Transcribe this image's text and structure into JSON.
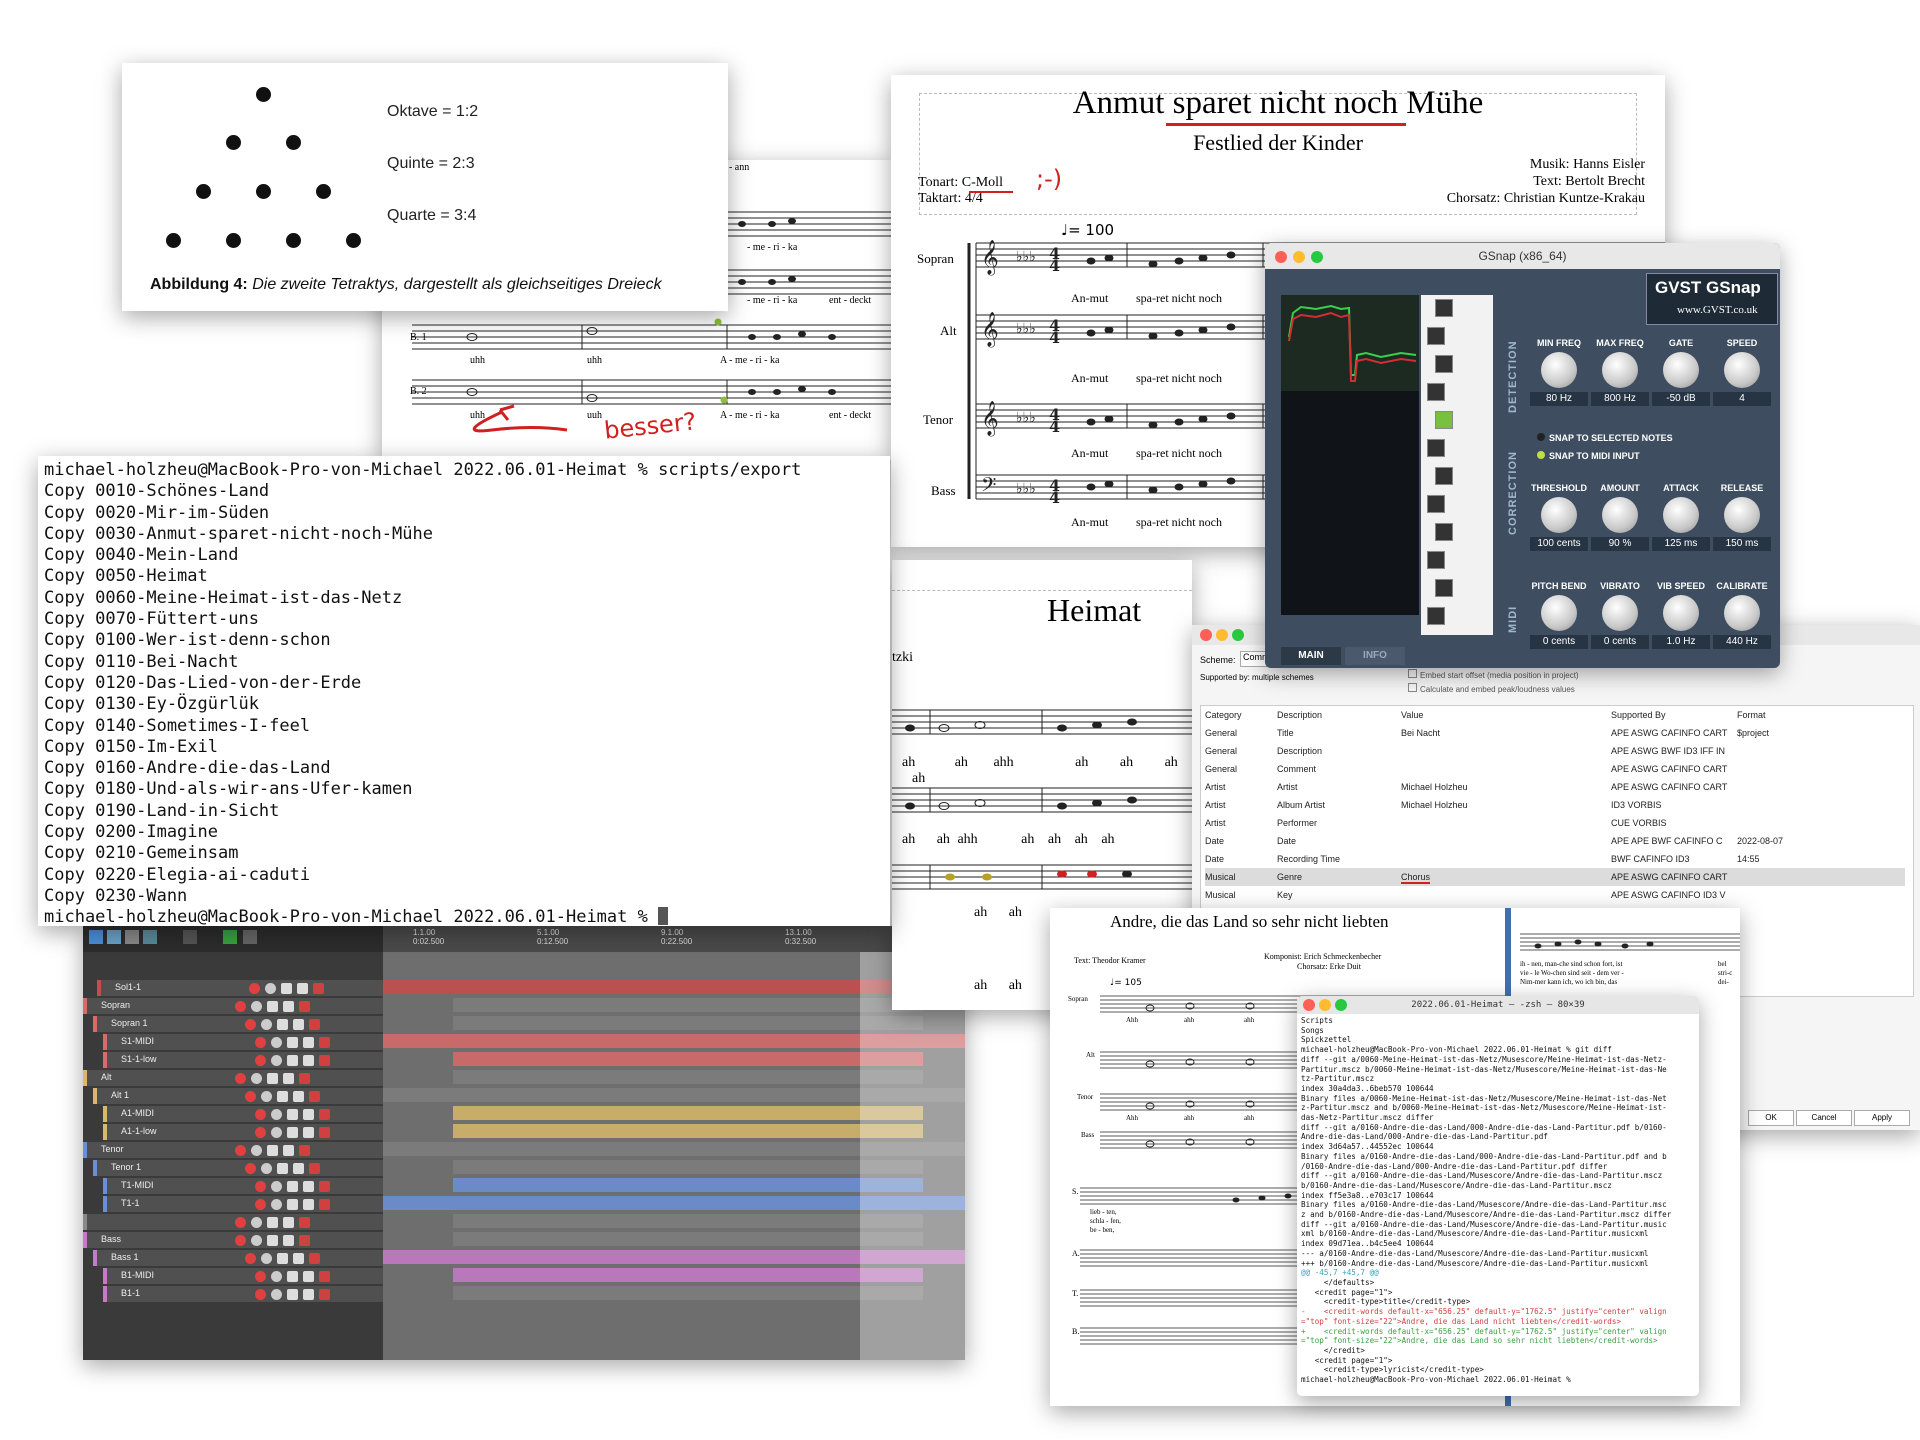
{
  "tetraktys": {
    "ratios": [
      "Oktave = 1:2",
      "Quinte = 2:3",
      "Quarte = 3:4"
    ],
    "caption_label": "Abbildung 4:",
    "caption_text": "Die zweite Tetraktys, dargestellt als gleichseitiges Dreieck"
  },
  "score_bg": {
    "lyrics": [
      "ann - ann",
      "- me - ri - ka",
      "- me - ri - ka",
      "ent - deckt",
      "uhh",
      "uhh",
      "A - me - ri - ka",
      "uhh",
      "uuh",
      "A - me - ri - ka",
      "ent - deckt"
    ],
    "staff_labels": [
      "B. 1",
      "B. 2"
    ],
    "annotation": "besser?"
  },
  "anmut": {
    "title": "Anmut sparet nicht noch Mühe",
    "subtitle": "Festlied der Kinder",
    "tonart": "Tonart: C-Moll",
    "smiley": ";-)",
    "taktart": "Taktart: 4/4",
    "musik": "Musik: Hanns Eisler",
    "text": "Text: Bertolt Brecht",
    "chorsatz": "Chorsatz: Christian Kuntze-Krakau",
    "tempo": "♩= 100",
    "parts": [
      "Sopran",
      "Alt",
      "Tenor",
      "Bass"
    ],
    "lyrics": [
      "An-mut",
      "spa-ret nicht noch"
    ]
  },
  "heimat": {
    "title": "Heimat",
    "partial": "tzki",
    "lyrics_row": [
      "ah",
      "ah",
      "ahh",
      "ah",
      "ah",
      "ah",
      "ah"
    ],
    "lyrics_row2": [
      "ah",
      "ah",
      "ahh",
      "ah",
      "ah",
      "ah",
      "ah"
    ],
    "lyrics_row3": [
      "ah",
      "ah"
    ],
    "lyrics_row4": [
      "ah",
      "ah"
    ]
  },
  "terminal": {
    "prompt": "michael-holzheu@MacBook-Pro-von-Michael 2022.06.01-Heimat % scripts/export",
    "lines": [
      "Copy 0010-Schönes-Land",
      "Copy 0020-Mir-im-Süden",
      "Copy 0030-Anmut-sparet-nicht-noch-Mühe",
      "Copy 0040-Mein-Land",
      "Copy 0050-Heimat",
      "Copy 0060-Meine-Heimat-ist-das-Netz",
      "Copy 0070-Füttert-uns",
      "Copy 0100-Wer-ist-denn-schon",
      "Copy 0110-Bei-Nacht",
      "Copy 0120-Das-Lied-von-der-Erde",
      "Copy 0130-Ey-Özgürlük",
      "Copy 0140-Sometimes-I-feel",
      "Copy 0150-Im-Exil",
      "Copy 0160-Andre-die-das-Land",
      "Copy 0180-Und-als-wir-ans-Ufer-kamen",
      "Copy 0190-Land-in-Sicht",
      "Copy 0200-Imagine",
      "Copy 0210-Gemeinsam",
      "Copy 0220-Elegia-ai-caduti",
      "Copy 0230-Wann"
    ],
    "end_prompt": "michael-holzheu@MacBook-Pro-von-Michael 2022.06.01-Heimat % "
  },
  "daw": {
    "ruler": [
      "1.1.00\n0:02.500",
      "5.1.00\n0:12.500",
      "9.1.00\n0:22.500",
      "13.1.00\n0:32.500",
      "17.1.00\n0:42.500"
    ],
    "tracks": [
      {
        "name": "Sol1-1",
        "color": "#c94b4b"
      },
      {
        "name": "Sopran",
        "color": "#d96a6a"
      },
      {
        "name": "Sopran 1",
        "color": "#d96a6a"
      },
      {
        "name": "S1-MIDI",
        "color": "#d96a6a"
      },
      {
        "name": "S1-1-low",
        "color": "#d96a6a"
      },
      {
        "name": "Alt",
        "color": "#d8b86a"
      },
      {
        "name": "Alt 1",
        "color": "#d8b86a"
      },
      {
        "name": "A1-MIDI",
        "color": "#d8b86a"
      },
      {
        "name": "A1-1-low",
        "color": "#d8b86a"
      },
      {
        "name": "Tenor",
        "color": "#6a8fd8"
      },
      {
        "name": "Tenor 1",
        "color": "#6a8fd8"
      },
      {
        "name": "T1-MIDI",
        "color": "#6a8fd8"
      },
      {
        "name": "T1-1",
        "color": "#6a8fd8"
      },
      {
        "name": "",
        "color": "#888888"
      },
      {
        "name": "Bass",
        "color": "#c77ac7"
      },
      {
        "name": "Bass 1",
        "color": "#c77ac7"
      },
      {
        "name": "B1-MIDI",
        "color": "#c77ac7"
      },
      {
        "name": "B1-1",
        "color": "#c77ac7"
      }
    ]
  },
  "gsnap": {
    "window_title": "GSnap (x86_64)",
    "logo": "GVST GSnap",
    "url": "www.GVST.co.uk",
    "sections": [
      "DETECTION",
      "CORRECTION",
      "MIDI"
    ],
    "detection": [
      {
        "label": "MIN FREQ",
        "value": "80 Hz"
      },
      {
        "label": "MAX FREQ",
        "value": "800 Hz"
      },
      {
        "label": "GATE",
        "value": "-50 dB"
      },
      {
        "label": "SPEED",
        "value": "4"
      }
    ],
    "options": [
      "SNAP TO SELECTED NOTES",
      "SNAP TO MIDI INPUT"
    ],
    "correction": [
      {
        "label": "THRESHOLD",
        "value": "100 cents"
      },
      {
        "label": "AMOUNT",
        "value": "90 %"
      },
      {
        "label": "ATTACK",
        "value": "125 ms"
      },
      {
        "label": "RELEASE",
        "value": "150 ms"
      }
    ],
    "midi": [
      {
        "label": "PITCH BEND",
        "value": "0 cents"
      },
      {
        "label": "VIBRATO",
        "value": "0 cents"
      },
      {
        "label": "VIB SPEED",
        "value": "1.0 Hz"
      },
      {
        "label": "CALIBRATE",
        "value": "440 Hz"
      }
    ],
    "tabs": [
      "MAIN",
      "INFO"
    ]
  },
  "metadata": {
    "scheme_label": "Scheme:",
    "scheme_value": "Comm",
    "supported_label": "Supported by:",
    "supported_value": "multiple schemes",
    "checkbox1": "Embed start offset (media position in project)",
    "checkbox2": "Calculate and embed peak/loudness values",
    "columns": [
      "Category",
      "Description",
      "Value",
      "Supported By",
      "Format"
    ],
    "rows": [
      [
        "General",
        "Title",
        "Bei Nacht",
        "APE ASWG CAFINFO CART",
        "$project"
      ],
      [
        "General",
        "Description",
        "",
        "APE ASWG BWF ID3 IFF IN",
        ""
      ],
      [
        "General",
        "Comment",
        "",
        "APE ASWG CAFINFO CART",
        ""
      ],
      [
        "Artist",
        "Artist",
        "Michael Holzheu",
        "APE ASWG CAFINFO CART",
        ""
      ],
      [
        "Artist",
        "Album Artist",
        "Michael Holzheu",
        "ID3 VORBIS",
        ""
      ],
      [
        "Artist",
        "Performer",
        "",
        "CUE VORBIS",
        ""
      ],
      [
        "Date",
        "Date",
        "",
        "APE APE BWF CAFINFO C",
        "2022-08-07"
      ],
      [
        "Date",
        "Recording Time",
        "",
        "BWF CAFINFO ID3",
        "14:55"
      ],
      [
        "Musical",
        "Genre",
        "Chorus",
        "APE ASWG CAFINFO CART",
        ""
      ],
      [
        "Musical",
        "Key",
        "",
        "APE ASWG CAFINFO ID3 V",
        ""
      ]
    ],
    "buttons": [
      "OK",
      "Cancel",
      "Apply"
    ]
  },
  "andre": {
    "title": "Andre, die das Land so sehr nicht liebten",
    "text_credit": "Text: Theodor Kramer",
    "komponist": "Komponist: Erich Schmeckenbecher",
    "chorsatz": "Chorsatz: Erke Duit",
    "tempo": "♩= 105",
    "parts": [
      "Sopran",
      "Alt",
      "Tenor",
      "Bass"
    ],
    "abbr": [
      "S.",
      "A.",
      "T.",
      "B."
    ],
    "lyrics": [
      "Ahh",
      "ahh",
      "ahh",
      "Ahh",
      "ahh",
      "ahh"
    ],
    "verse": [
      "lieb - ten,",
      "schla - fen,",
      "be - ben,",
      "war'n",
      "und",
      "wie",
      "von",
      "es",
      "so",
      "An - fang",
      "ist",
      "mir",
      "sich",
      "auch",
      "aus"
    ],
    "right_lyrics": [
      "ih - nen, man-che sind schon fort, ist",
      "vie - le   Wo-chen sind seit - dem ver -",
      "Nim-mer kann ich, wo   ich  bin,  das"
    ],
    "right_tail": [
      "bel",
      "stri-c",
      "dei-"
    ]
  },
  "term2": {
    "title": "2022.06.01-Heimat — -zsh — 80×39",
    "lines": [
      {
        "t": "Scripts",
        "c": "#111"
      },
      {
        "t": "Songs",
        "c": "#111"
      },
      {
        "t": "Spickzettel",
        "c": "#111"
      },
      {
        "t": "michael-holzheu@MacBook-Pro-von-Michael 2022.06.01-Heimat % git diff",
        "c": "#111"
      },
      {
        "t": "diff --git a/0060-Meine-Heimat-ist-das-Netz/Musescore/Meine-Heimat-ist-das-Netz-",
        "c": "#111"
      },
      {
        "t": "Partitur.mscz b/0060-Meine-Heimat-ist-das-Netz/Musescore/Meine-Heimat-ist-das-Ne",
        "c": "#111"
      },
      {
        "t": "tz-Partitur.mscz",
        "c": "#111"
      },
      {
        "t": "index 30a4da3..6beb570 100644",
        "c": "#111"
      },
      {
        "t": "Binary files a/0060-Meine-Heimat-ist-das-Netz/Musescore/Meine-Heimat-ist-das-Net",
        "c": "#111"
      },
      {
        "t": "z-Partitur.mscz and b/0060-Meine-Heimat-ist-das-Netz/Musescore/Meine-Heimat-ist-",
        "c": "#111"
      },
      {
        "t": "das-Netz-Partitur.mscz differ",
        "c": "#111"
      },
      {
        "t": "diff --git a/0160-Andre-die-das-Land/000-Andre-die-das-Land-Partitur.pdf b/0160-",
        "c": "#111"
      },
      {
        "t": "Andre-die-das-Land/000-Andre-die-das-Land-Partitur.pdf",
        "c": "#111"
      },
      {
        "t": "index 3d64a57..44552ec 100644",
        "c": "#111"
      },
      {
        "t": "Binary files a/0160-Andre-die-das-Land/000-Andre-die-das-Land-Partitur.pdf and b",
        "c": "#111"
      },
      {
        "t": "/0160-Andre-die-das-Land/000-Andre-die-das-Land-Partitur.pdf differ",
        "c": "#111"
      },
      {
        "t": "diff --git a/0160-Andre-die-das-Land/Musescore/Andre-die-das-Land-Partitur.mscz",
        "c": "#111"
      },
      {
        "t": "b/0160-Andre-die-das-Land/Musescore/Andre-die-das-Land-Partitur.mscz",
        "c": "#111"
      },
      {
        "t": "index ff5e3a8..e703c17 100644",
        "c": "#111"
      },
      {
        "t": "Binary files a/0160-Andre-die-das-Land/Musescore/Andre-die-das-Land-Partitur.msc",
        "c": "#111"
      },
      {
        "t": "z and b/0160-Andre-die-das-Land/Musescore/Andre-die-das-Land-Partitur.mscz differ",
        "c": "#111"
      },
      {
        "t": "diff --git a/0160-Andre-die-das-Land/Musescore/Andre-die-das-Land-Partitur.music",
        "c": "#111"
      },
      {
        "t": "xml b/0160-Andre-die-das-Land/Musescore/Andre-die-das-Land-Partitur.musicxml",
        "c": "#111"
      },
      {
        "t": "index 09d71ea..b4c5ee4 100644",
        "c": "#111"
      },
      {
        "t": "--- a/0160-Andre-die-das-Land/Musescore/Andre-die-das-Land-Partitur.musicxml",
        "c": "#111"
      },
      {
        "t": "+++ b/0160-Andre-die-das-Land/Musescore/Andre-die-das-Land-Partitur.musicxml",
        "c": "#111"
      },
      {
        "t": "@@ -45,7 +45,7 @@",
        "c": "#3aa0c8"
      },
      {
        "t": "     </defaults>",
        "c": "#111"
      },
      {
        "t": "   <credit page=\"1\">",
        "c": "#111"
      },
      {
        "t": "     <credit-type>title</credit-type>",
        "c": "#111"
      },
      {
        "t": "-    <credit-words default-x=\"656.25\" default-y=\"1762.5\" justify=\"center\" valign",
        "c": "#d04040"
      },
      {
        "t": "=\"top\" font-size=\"22\">Andre, die das Land nicht liebten</credit-words>",
        "c": "#d04040"
      },
      {
        "t": "+    <credit-words default-x=\"656.25\" default-y=\"1762.5\" justify=\"center\" valign",
        "c": "#3aa040"
      },
      {
        "t": "=\"top\" font-size=\"22\">Andre, die das Land so sehr nicht liebten</credit-words>",
        "c": "#3aa040"
      },
      {
        "t": "     </credit>",
        "c": "#111"
      },
      {
        "t": "   <credit page=\"1\">",
        "c": "#111"
      },
      {
        "t": "     <credit-type>lyricist</credit-type>",
        "c": "#111"
      },
      {
        "t": "michael-holzheu@MacBook-Pro-von-Michael 2022.06.01-Heimat % ",
        "c": "#111"
      }
    ]
  }
}
